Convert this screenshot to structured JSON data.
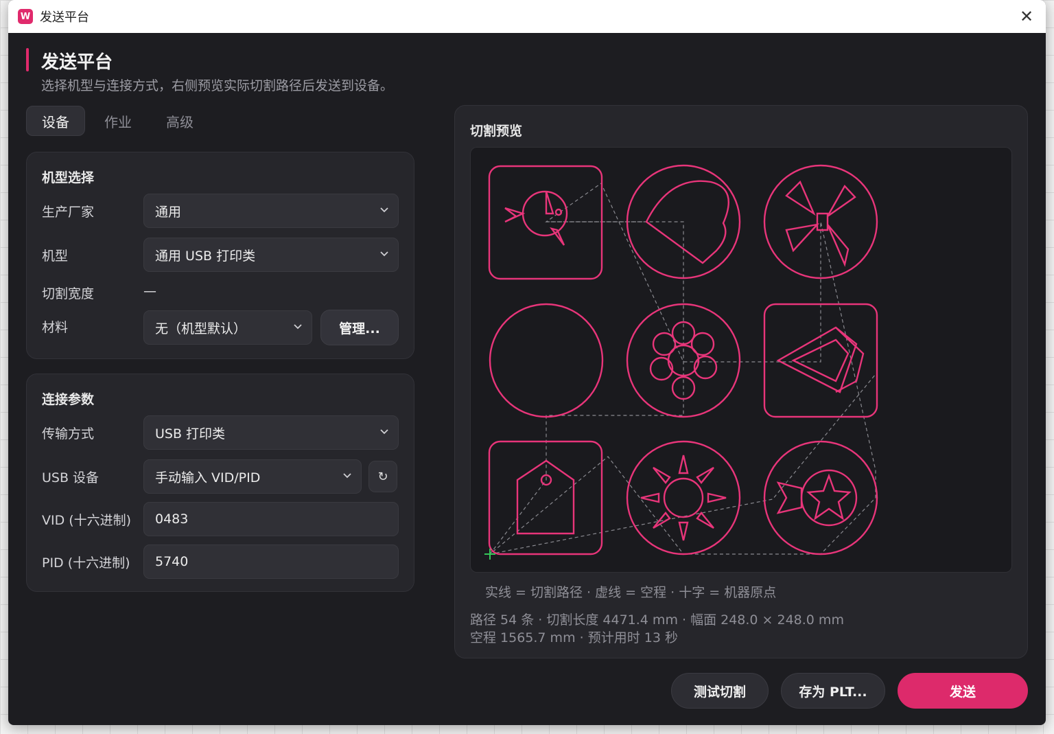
{
  "window": {
    "title": "发送平台",
    "app_icon_letter": "W",
    "close_glyph": "✕"
  },
  "header": {
    "title": "发送平台",
    "subtitle": "选择机型与连接方式，右侧预览实际切割路径后发送到设备。"
  },
  "tabs": [
    {
      "label": "设备",
      "active": true
    },
    {
      "label": "作业",
      "active": false
    },
    {
      "label": "高级",
      "active": false
    }
  ],
  "machine_card": {
    "title": "机型选择",
    "manufacturer_label": "生产厂家",
    "manufacturer_value": "通用",
    "model_label": "机型",
    "model_value": "通用 USB 打印类",
    "width_label": "切割宽度",
    "width_value": "—",
    "material_label": "材料",
    "material_value": "无（机型默认）",
    "manage_label": "管理..."
  },
  "connection_card": {
    "title": "连接参数",
    "transport_label": "传输方式",
    "transport_value": "USB 打印类",
    "usb_device_label": "USB 设备",
    "usb_device_value": "手动输入 VID/PID",
    "refresh_glyph": "↻",
    "vid_label": "VID (十六进制)",
    "vid_value": "0483",
    "pid_label": "PID (十六进制)",
    "pid_value": "5740"
  },
  "preview": {
    "title": "切割预览",
    "legend": "实线 = 切割路径 · 虚线 = 空程 · 十字 = 机器原点",
    "stats_line1": "路径 54 条 · 切割长度 4471.4 mm · 幅面 248.0 × 248.0 mm",
    "stats_line2": "空程 1565.7 mm · 预计用时 13 秒"
  },
  "footer": {
    "test_cut_label": "测试切割",
    "save_plt_label": "存为 PLT...",
    "send_label": "发送"
  },
  "colors": {
    "accent": "#e02a6c",
    "cut_path": "#e8357a",
    "origin": "#34c759"
  }
}
